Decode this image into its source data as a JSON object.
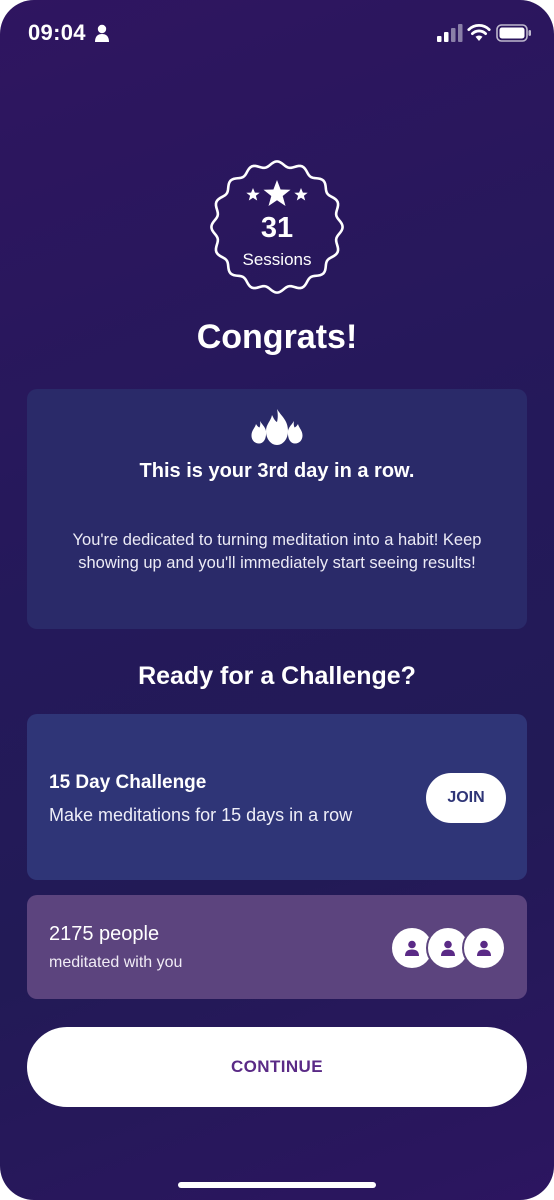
{
  "status_bar": {
    "time": "09:04",
    "icons": [
      "person-icon",
      "signal-icon",
      "wifi-icon",
      "battery-icon"
    ]
  },
  "badge": {
    "count": "31",
    "label": "Sessions",
    "icon": "stars-icon"
  },
  "congrats_title": "Congrats!",
  "streak_card": {
    "icon": "flame-icon",
    "title": "This is your 3rd day in a row.",
    "body": "You're dedicated to turning meditation into a habit! Keep showing up and you'll immediately start seeing results!"
  },
  "challenge_heading": "Ready for a Challenge?",
  "challenge_card": {
    "title": "15 Day Challenge",
    "description": "Make meditations for 15 days in a row",
    "join_label": "JOIN"
  },
  "community_card": {
    "count_text": "2175 people",
    "subtitle": "meditated with you",
    "avatar_icon": "person-icon"
  },
  "continue_label": "CONTINUE",
  "colors": {
    "background": "#251a5b",
    "streak_card": "#2a2a69",
    "challenge_card": "#2f3577",
    "community_card": "#5c447e",
    "accent_text": "#5a2a86"
  }
}
